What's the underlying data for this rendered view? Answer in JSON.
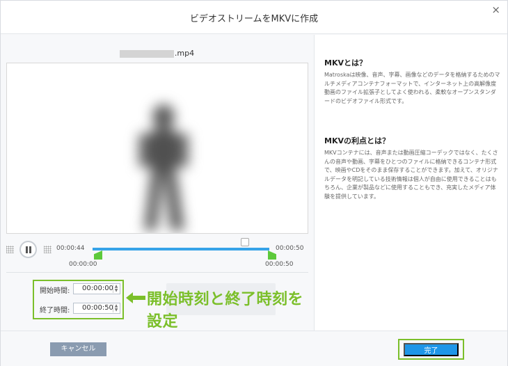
{
  "window": {
    "title": "ビデオストリームをMKVに作成",
    "close_symbol": "×"
  },
  "video": {
    "filename_suffix": ".mp4"
  },
  "player": {
    "current_time": "00:00:44",
    "end_time": "00:00:50",
    "start_marker": "00:00:00",
    "end_marker": "00:00:50"
  },
  "time_settings": {
    "start_label": "開始時間:",
    "start_value": "00:00:00",
    "end_label": "終了時間:",
    "end_value": "00:00:50",
    "ghost_text": "00:0"
  },
  "annotation": {
    "text": "開始時刻と終了時刻を設定",
    "color": "#7bbf2a"
  },
  "info": {
    "heading1": "MKVとは？",
    "para1": "Matroskaは映像、音声、字幕、画像などのデータを格納するためのマルチメディアコンテナフォーマットで、インターネット上の高解像度動画のファイル拡張子としてよく使われる、柔軟なオープンスタンダードのビデオファイル形式です。",
    "heading2": "MKVの利点とは？",
    "para2": "MKVコンテナには、音声または動画圧縮コーデックではなく、たくさんの音声や動画、字幕をひとつのファイルに格納できるコンテナ形式で、映画やCDをそのまま保存することができます。加えて、オリジナルデータを明記している技術情報は個人が自由に使用できることはもちろん、企業が製品などに使用することもでき、充実したメディア体験を提供しています。"
  },
  "footer": {
    "cancel_label": "キャンセル",
    "done_label": "完了"
  },
  "colors": {
    "accent": "#1e96e8",
    "track": "#36a3e8",
    "marker": "#5dc93b",
    "cancel_bg": "#8a9bb0"
  }
}
